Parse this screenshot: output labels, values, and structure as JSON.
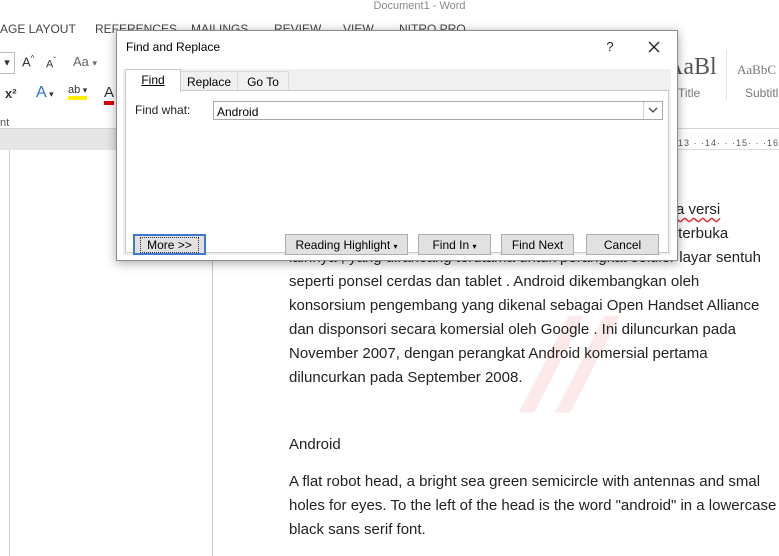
{
  "window": {
    "doc_title": "Document1 - Word"
  },
  "ribbon_tabs": [
    "AGE LAYOUT",
    "REFERENCES",
    "MAILINGS",
    "REVIEW",
    "VIEW",
    "NITRO PRO"
  ],
  "ribbon": {
    "font_size_up": "A",
    "font_size_down": "A",
    "change_case": "Aa",
    "superscript": "x²",
    "text_effects": "A",
    "highlight": "ab",
    "font_color": "A",
    "group_label": "nt",
    "styles": [
      {
        "preview": "AaBl",
        "name": "Title"
      },
      {
        "preview": "AaBbC",
        "name": "Subtitl"
      }
    ]
  },
  "ruler_ticks": "13 · ·14· · ·15· · ·16",
  "document": {
    "paragraph1_lines": [
      "pada versi",
      "r terbuka",
      "lainnya , yang dirancang terutama untuk perangkat seluler layar sentuh",
      "seperti ponsel cerdas dan tablet . Android dikembangkan oleh",
      "konsorsium pengembang yang dikenal sebagai Open Handset Alliance",
      "dan disponsori secara komersial oleh Google . Ini diluncurkan pada",
      "November 2007, dengan perangkat Android komersial pertama",
      "diluncurkan pada September 2008."
    ],
    "heading2": "Android",
    "paragraph2": "A flat robot head, a bright sea green semicircle with antennas and smal holes for eyes. To the left of the head is the word \"android\" in a lowercase black sans serif font."
  },
  "dialog": {
    "title": "Find and Replace",
    "help_label": "?",
    "tabs": {
      "find": "Find",
      "replace": "Replace",
      "goto": "Go To"
    },
    "find_what_label": "Find what:",
    "find_what_value": "Android",
    "buttons": {
      "more": "More >>",
      "reading_highlight": "Reading Highlight",
      "find_in": "Find In",
      "find_next": "Find Next",
      "cancel": "Cancel"
    }
  }
}
